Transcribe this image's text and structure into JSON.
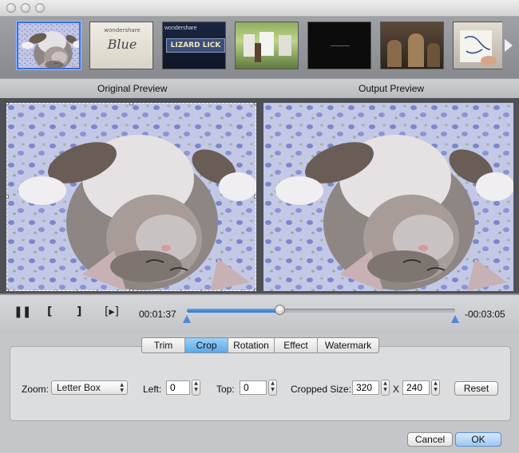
{
  "window": {
    "titlebar_buttons": [
      "close",
      "minimize",
      "zoom"
    ]
  },
  "filmstrip": {
    "thumbnails": [
      {
        "name": "kitten",
        "selected": true
      },
      {
        "name": "blue-title",
        "text": "Blue",
        "subtext": "wondershare"
      },
      {
        "name": "wizard-logo",
        "text": "LIZARD LICK",
        "subtext": "wondershare"
      },
      {
        "name": "laundry-scene"
      },
      {
        "name": "dark-frame"
      },
      {
        "name": "market-scene"
      },
      {
        "name": "drawing-scene"
      }
    ],
    "next_icon": "chevron-right-icon"
  },
  "preview": {
    "original_label": "Original Preview",
    "output_label": "Output Preview"
  },
  "playback": {
    "current_time": "00:01:37",
    "remaining_time": "-00:03:05",
    "progress": 0.35,
    "icons": [
      "pause-icon",
      "mark-in-icon",
      "mark-out-icon",
      "next-frame-icon"
    ]
  },
  "settings": {
    "tabs": [
      {
        "label": "Trim",
        "active": false
      },
      {
        "label": "Crop",
        "active": true
      },
      {
        "label": "Rotation",
        "active": false
      },
      {
        "label": "Effect",
        "active": false
      },
      {
        "label": "Watermark",
        "active": false
      }
    ],
    "zoom_label": "Zoom:",
    "zoom_value": "Letter Box",
    "left_label": "Left:",
    "left_value": "0",
    "top_label": "Top:",
    "top_value": "0",
    "cropped_size_label": "Cropped Size:",
    "width_value": "320",
    "x_label": "X",
    "height_value": "240",
    "reset_label": "Reset"
  },
  "footer": {
    "cancel_label": "Cancel",
    "ok_label": "OK"
  },
  "colors": {
    "accent": "#3b6fe0",
    "active_tab": "#6db4ee",
    "progress_fill": "#3a80d4"
  }
}
